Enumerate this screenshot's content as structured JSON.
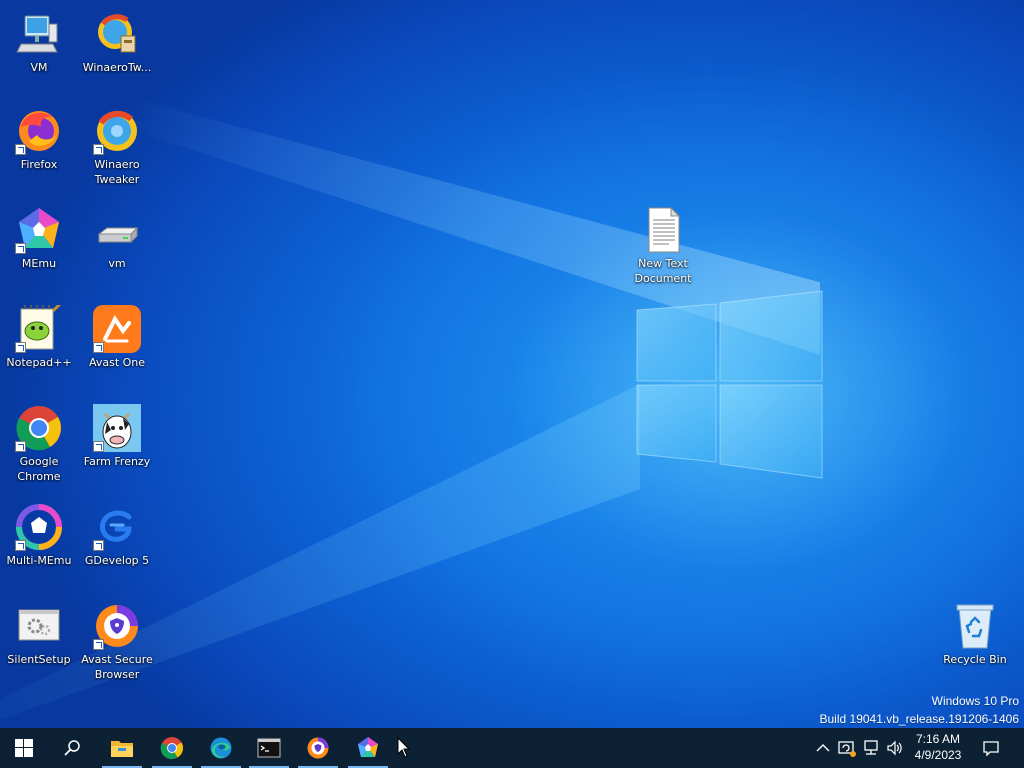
{
  "desktop": {
    "icons": [
      {
        "label": "VM",
        "kind": "computer-icon"
      },
      {
        "label": "WinaeroTw...",
        "kind": "winaero-setup-icon"
      },
      {
        "label": "Firefox",
        "kind": "firefox-icon"
      },
      {
        "label": "Winaero Tweaker",
        "kind": "winaero-icon"
      },
      {
        "label": "MEmu",
        "kind": "memu-icon"
      },
      {
        "label": "vm",
        "kind": "drive-icon"
      },
      {
        "label": "Notepad++",
        "kind": "notepadpp-icon"
      },
      {
        "label": "Avast One",
        "kind": "avast-one-icon"
      },
      {
        "label": "Google Chrome",
        "kind": "chrome-icon"
      },
      {
        "label": "Farm Frenzy",
        "kind": "farm-frenzy-icon"
      },
      {
        "label": "Multi-MEmu",
        "kind": "multi-memu-icon"
      },
      {
        "label": "GDevelop 5",
        "kind": "gdevelop-icon"
      },
      {
        "label": "SilentSetup",
        "kind": "silentsetup-icon"
      },
      {
        "label": "Avast Secure Browser",
        "kind": "avast-browser-icon"
      },
      {
        "label": "New Text Document",
        "kind": "text-document-icon"
      },
      {
        "label": "Recycle Bin",
        "kind": "recycle-bin-icon"
      }
    ],
    "watermark": {
      "edition": "Windows 10 Pro",
      "build": "Build 19041.vb_release.191206-1406"
    }
  },
  "taskbar": {
    "start": "windows-start-icon",
    "search": "search-icon",
    "apps": [
      "file-explorer-icon",
      "chrome-icon",
      "edge-icon",
      "terminal-icon",
      "avast-browser-icon",
      "memu-icon"
    ],
    "tray": {
      "overflow": "chevron-up-icon",
      "icons": [
        "update-icon",
        "network-icon",
        "volume-icon"
      ],
      "time": "7:16 AM",
      "date": "4/9/2023",
      "notifications": "action-center-icon"
    }
  },
  "colors": {
    "taskbar": "#0c2134",
    "desktop": "#0a4fc0",
    "accent": "#7ab8f5"
  }
}
